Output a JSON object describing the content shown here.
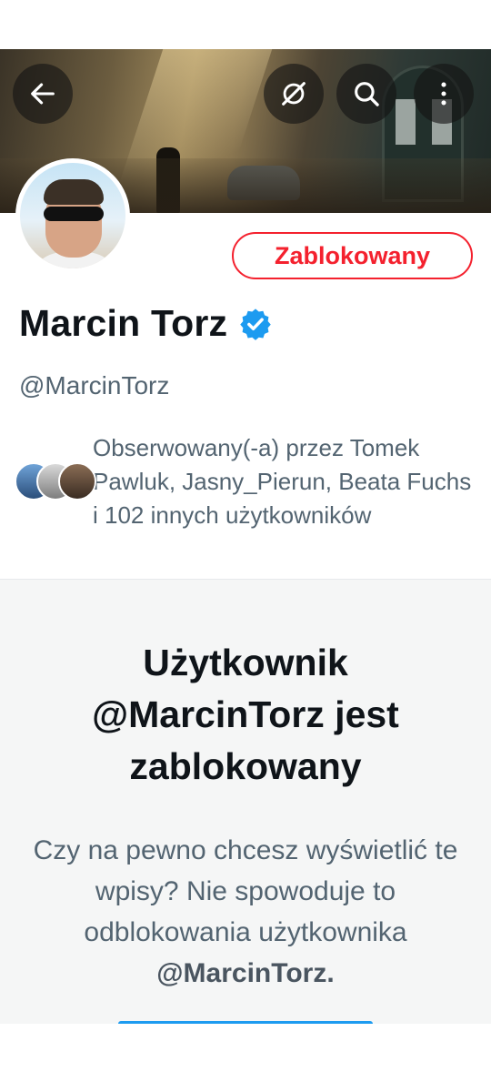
{
  "profile": {
    "display_name": "Marcin Torz",
    "handle": "@MarcinTorz",
    "blocked_label": "Zablokowany",
    "followed_by": "Obserwowany(-a) przez Tomek Pawluk, Jasny_Pierun, Beata Fuchs i 102 innych użytkowników"
  },
  "blocked_notice": {
    "title": "Użytkownik @MarcinTorz jest zablokowany",
    "description": "Czy na pewno chcesz wyświetlić te wpisy? Nie spowoduje to odblokowania użytkownika",
    "handle": "@MarcinTorz."
  },
  "colors": {
    "accent": "#1d9bf0",
    "danger": "#f4212e",
    "secondary_text": "#536471"
  },
  "icons": {
    "back": "arrow-left-icon",
    "unmute": "no-sound-icon",
    "search": "search-icon",
    "more": "more-vertical-icon",
    "verified": "verified-badge-icon"
  }
}
